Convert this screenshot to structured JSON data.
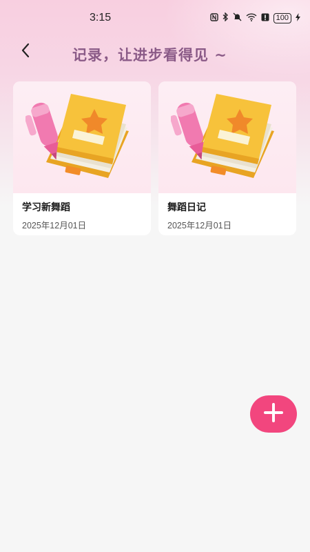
{
  "status_bar": {
    "time": "3:15",
    "battery": "100",
    "icons": [
      "nfc-icon",
      "bluetooth-icon",
      "mute-icon",
      "wifi-icon",
      "alert-icon",
      "battery-icon",
      "charging-icon"
    ]
  },
  "header": {
    "back_icon": "chevron-left-icon",
    "slogan": "记录，让进步看得见 ~"
  },
  "notebooks": [
    {
      "title": "学习新舞蹈",
      "date": "2025年12月01日",
      "cover_icon": "notebook-pen-icon"
    },
    {
      "title": "舞蹈日记",
      "date": "2025年12月01日",
      "cover_icon": "notebook-pen-icon"
    }
  ],
  "fab": {
    "icon": "plus-icon"
  },
  "colors": {
    "accent": "#f2467e",
    "slogan": "#8a5a87",
    "background": "#f6f6f6",
    "notebook_yellow": "#f7c23b",
    "pen_pink": "#f17ab0"
  }
}
